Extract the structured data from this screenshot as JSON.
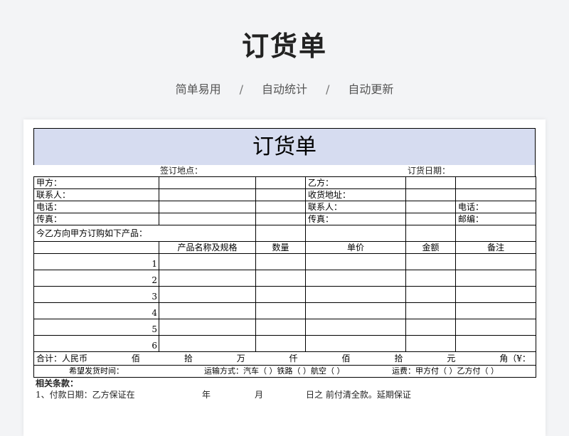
{
  "hero": {
    "title": "订货单",
    "tags": [
      "简单易用",
      "自动统计",
      "自动更新"
    ],
    "separator": "/"
  },
  "form": {
    "title": "订货单",
    "sign_place_label": "签订地点：",
    "order_date_label": "订货日期：",
    "party_rows": [
      {
        "left": "甲方：",
        "right": "乙方：",
        "extra": ""
      },
      {
        "left": "联系人：",
        "right": "收货地址：",
        "extra": ""
      },
      {
        "left": "电话：",
        "right": "联系人：",
        "extra": "电话："
      },
      {
        "left": "传真：",
        "right": "传真：",
        "extra": "邮编："
      }
    ],
    "intro": "今乙方向甲方订购如下产品：",
    "headers": [
      "产品名称及规格",
      "数量",
      "单价",
      "金额",
      "备注"
    ],
    "item_numbers": [
      "1",
      "2",
      "3",
      "4",
      "5",
      "6"
    ],
    "total": {
      "label": "合计：人民币",
      "units": [
        "佰",
        "拾",
        "万",
        "仟",
        "佰",
        "拾",
        "元",
        "角（¥："
      ]
    },
    "shipping": {
      "date": "希望发货时间：",
      "method": "运输方式：汽车（ ）铁路（ ）航空（ ）",
      "fee": "运费：甲方付（ ）乙方付（ ）"
    }
  },
  "clauses": {
    "heading": "相关条款：",
    "line1_parts": [
      "1、付款日期：乙方保证在",
      "年",
      "月",
      "日之 前付清全款。延期保证"
    ]
  }
}
